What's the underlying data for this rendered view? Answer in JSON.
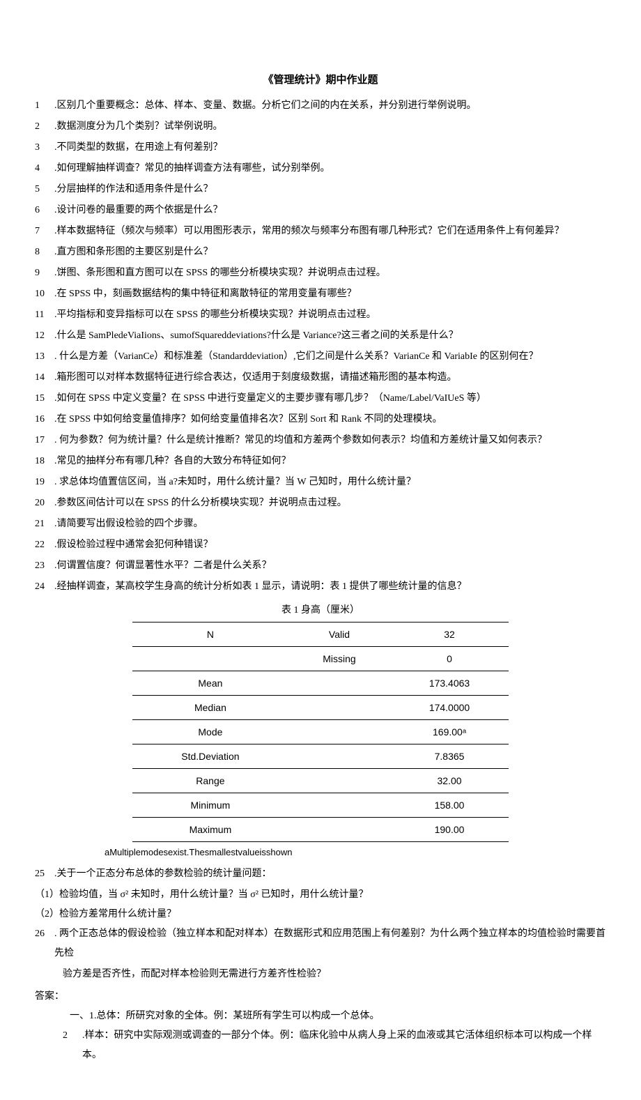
{
  "title": "《管理统计》期中作业题",
  "questions": [
    {
      "num": "1",
      "text": ".区别几个重要概念：总体、样本、变量、数据。分析它们之间的内在关系，并分别进行举例说明。"
    },
    {
      "num": "2",
      "text": ".数据测度分为几个类别？试举例说明。"
    },
    {
      "num": "3",
      "text": ".不同类型的数据，在用途上有何差别？"
    },
    {
      "num": "4",
      "text": ".如何理解抽样调查？常见的抽样调查方法有哪些，试分别举例。"
    },
    {
      "num": "5",
      "text": ".分层抽样的作法和适用条件是什么？"
    },
    {
      "num": "6",
      "text": ".设计问卷的最重要的两个依据是什么？"
    },
    {
      "num": "7",
      "text": ".样本数据特征（频次与频率）可以用图形表示，常用的频次与频率分布图有哪几种形式？它们在适用条件上有何差异？"
    },
    {
      "num": "8",
      "text": ".直方图和条形图的主要区别是什么？"
    },
    {
      "num": "9",
      "text": ".饼图、条形图和直方图可以在 SPSS 的哪些分析模块实现？并说明点击过程。"
    },
    {
      "num": "10",
      "text": ".在 SPSS 中，刻画数据结构的集中特征和离散特征的常用变量有哪些？"
    },
    {
      "num": "11",
      "text": ".平均指标和变异指标可以在 SPSS 的哪些分析模块实现？并说明点击过程。"
    },
    {
      "num": "12",
      "text": ".什么是 SamPledeViaIions、sumofSquareddeviations?什么是 Variance?这三者之间的关系是什么？"
    },
    {
      "num": "13",
      "text": ". 什么是方差（VarianCe）和标准差（Standarddeviation）,它们之间是什么关系？VarianCe 和 VariabIe 的区别何在？"
    },
    {
      "num": "14",
      "text": ".箱形图可以对样本数据特征进行综合表达，仅适用于刻度级数据，请描述箱形图的基本构造。"
    },
    {
      "num": "15",
      "text": ".如何在 SPSS 中定义变量？在 SPSS 中进行变量定义的主要步骤有哪几步？（Name/Label/VaIUeS 等）"
    },
    {
      "num": "16",
      "text": ".在 SPSS 中如何给变量值排序？如何给变量值排名次？区别 Sort 和 Rank 不同的处理模块。"
    },
    {
      "num": "17",
      "text": ". 何为参数？何为统计量？什么是统计推断？常见的均值和方差两个参数如何表示？均值和方差统计量又如何表示？"
    },
    {
      "num": "18",
      "text": ".常见的抽样分布有哪几种？各自的大致分布特征如何？"
    },
    {
      "num": "19",
      "text": ". 求总体均值置信区间，当 a?未知时，用什么统计量？当 W 己知时，用什么统计量？"
    },
    {
      "num": "20",
      "text": ".参数区间估计可以在 SPSS 的什么分析模块实现？并说明点击过程。"
    },
    {
      "num": "21",
      "text": ".请简要写出假设检验的四个步骤。"
    },
    {
      "num": "22",
      "text": ".假设检验过程中通常会犯何种错误？"
    },
    {
      "num": "23",
      "text": ".何谓置信度？何谓显著性水平？二者是什么关系？"
    },
    {
      "num": "24",
      "text": ".经抽样调查，某高校学生身高的统计分析如表 1 显示，请说明：表 1 提供了哪些统计量的信息？"
    }
  ],
  "table": {
    "caption": "表 1 身高（厘米）",
    "rows": [
      [
        "N",
        "Valid",
        "32"
      ],
      [
        "",
        "Missing",
        "0"
      ],
      [
        "Mean",
        "",
        "173.4063"
      ],
      [
        "Median",
        "",
        "174.0000"
      ],
      [
        "Mode",
        "",
        "169.00ᵃ"
      ],
      [
        "Std.Deviation",
        "",
        "7.8365"
      ],
      [
        "Range",
        "",
        "32.00"
      ],
      [
        "Minimum",
        "",
        "158.00"
      ],
      [
        "Maximum",
        "",
        "190.00"
      ]
    ],
    "footnote": "aMultiplemodesexist.Thesmallestvalueisshown"
  },
  "questions_after": [
    {
      "num": "25",
      "text": ".关于一个正态分布总体的参数检验的统计量问题："
    }
  ],
  "sub_questions_25": [
    "（1）检验均值，当 σ² 未知时，用什么统计量？当 σ² 已知时，用什么统计量？",
    "（2）检验方差常用什么统计量？"
  ],
  "question_26": {
    "num": "26",
    "line1": ". 两个正态总体的假设检验（独立样本和配对样本）在数据形式和应用范围上有何差别？为什么两个独立样本的均值检验时需要首先检",
    "line2": "验方差是否齐性，而配对样本检验则无需进行方差齐性检验？"
  },
  "answer_label": "答案：",
  "answers": [
    {
      "prefix": "一、1.总体：所研究对象的全体。例：某班所有学生可以构成一个总体。"
    },
    {
      "num": "2",
      "text": ".样本：研究中实际观测或调查的一部分个体。例：临床化验中从病人身上采的血液或其它活体组织标本可以构成一个样本。"
    }
  ]
}
